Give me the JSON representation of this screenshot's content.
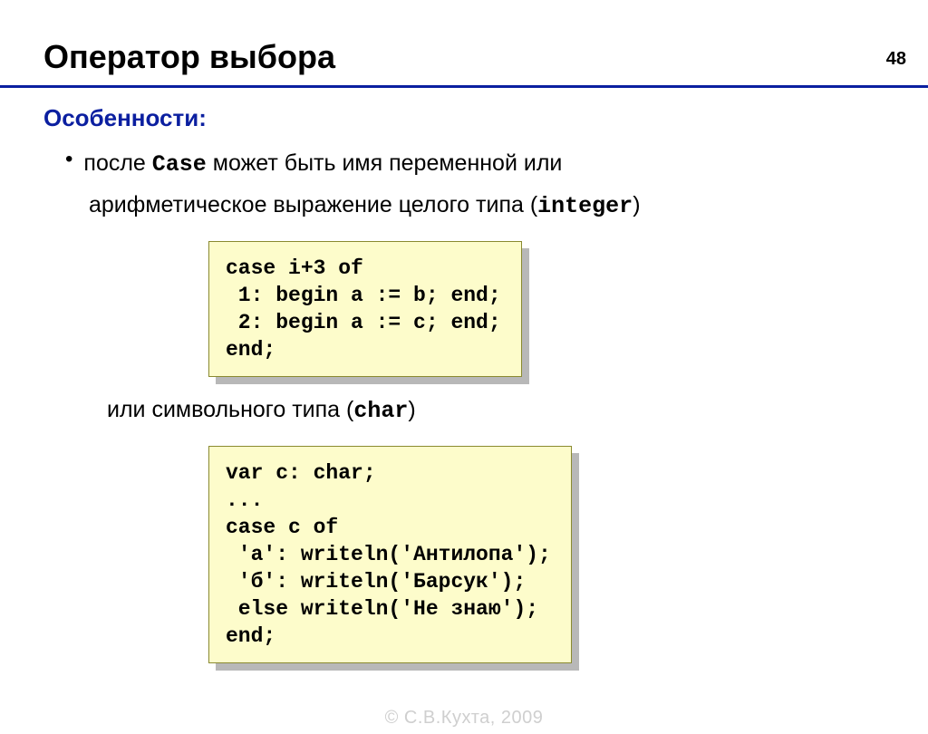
{
  "page_number": "48",
  "title": "Оператор выбора",
  "section": "Особенности:",
  "bullet": {
    "line1_pre": "после ",
    "line1_mono": "Case",
    "line1_post": " может быть имя переменной или",
    "line2_pre": "арифметическое выражение целого типа (",
    "line2_mono": "integer",
    "line2_post": ")"
  },
  "code1": "case i+3 of\n 1: begin a := b; end;\n 2: begin a := c; end;\nend;",
  "between": {
    "pre": "или символьного типа (",
    "mono": "char",
    "post": ")"
  },
  "code2": "var c: char;\n...\ncase c of\n 'а': writeln('Антилопа');\n 'б': writeln('Барсук');\n else writeln('Не знаю');\nend;",
  "footer": "© С.В.Кухта, 2009"
}
